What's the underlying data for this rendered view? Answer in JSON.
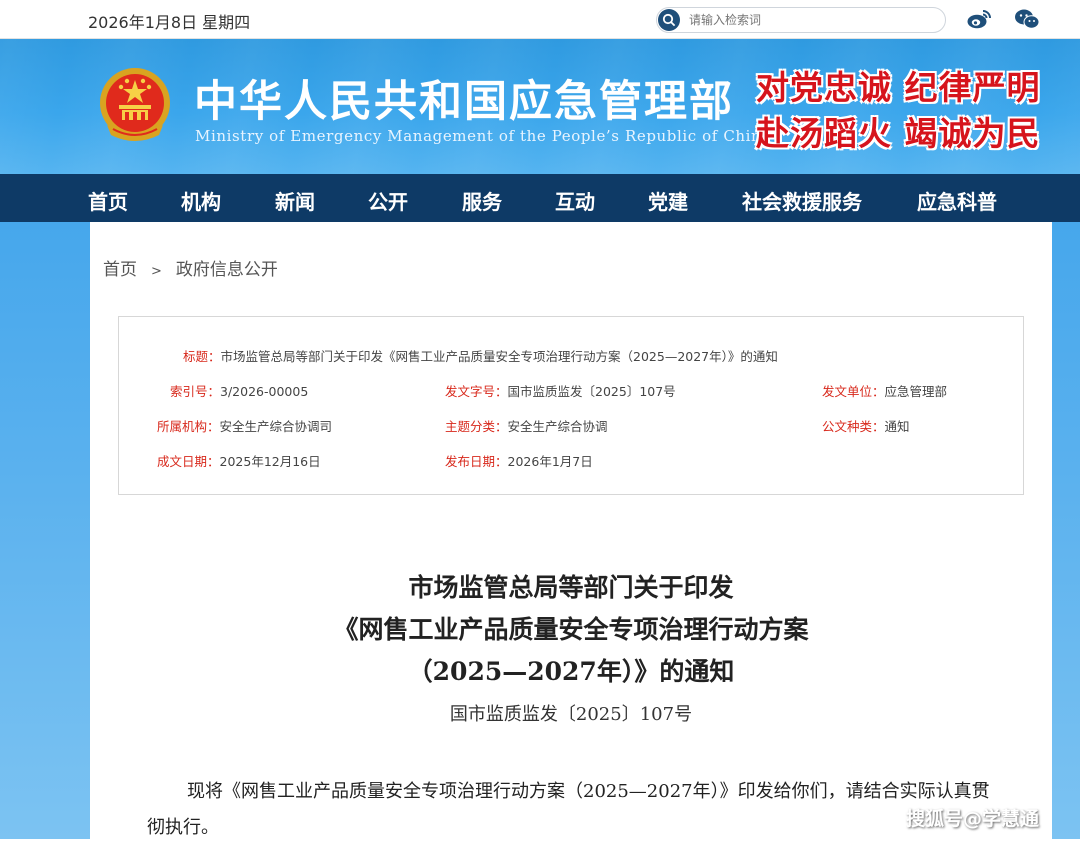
{
  "topbar": {
    "date": "2026年1月8日 星期四",
    "search_placeholder": "请输入检索词",
    "icons": [
      "search-icon",
      "weibo-icon",
      "wechat-icon"
    ]
  },
  "banner": {
    "title": "中华人民共和国应急管理部",
    "subtitle": "Ministry of Emergency Management of the People’s Republic of China",
    "slogan_line1": "对党忠诚 纪律严明",
    "slogan_line2": "赴汤蹈火 竭诚为民",
    "colors": {
      "banner_blue": "#3aa6ec",
      "slogan_red": "#d6141c",
      "nav_navy": "#0e3a66"
    }
  },
  "nav": {
    "items": [
      "首页",
      "机构",
      "新闻",
      "公开",
      "服务",
      "互动",
      "党建",
      "社会救援服务",
      "应急科普"
    ]
  },
  "breadcrumb": {
    "home": "首页",
    "separator": ">",
    "current": "政府信息公开"
  },
  "info": {
    "title_label": "标题：",
    "title_value": "市场监管总局等部门关于印发《网售工业产品质量安全专项治理行动方案（2025—2027年）》的通知",
    "index_label": "索引号：",
    "index_value": "3/2026-00005",
    "docno_label": "发文字号：",
    "docno_value": "国市监质监发〔2025〕107号",
    "issuer_label": "发文单位：",
    "issuer_value": "应急管理部",
    "org_label": "所属机构：",
    "org_value": "安全生产综合协调司",
    "topic_label": "主题分类：",
    "topic_value": "安全生产综合协调",
    "type_label": "公文种类：",
    "type_value": "通知",
    "written_label": "成文日期：",
    "written_value": "2025年12月16日",
    "published_label": "发布日期：",
    "published_value": "2026年1月7日",
    "label_color": "#d8291c"
  },
  "document": {
    "title_line1": "市场监管总局等部门关于印发",
    "title_line2": "《网售工业产品质量安全专项治理行动方案",
    "title_line3": "（2025—2027年）》的通知",
    "number": "国市监质监发〔2025〕107号",
    "body": "现将《网售工业产品质量安全专项治理行动方案（2025—2027年）》印发给你们，请结合实际认真贯彻执行。"
  },
  "watermark": "搜狐号@学慧通"
}
